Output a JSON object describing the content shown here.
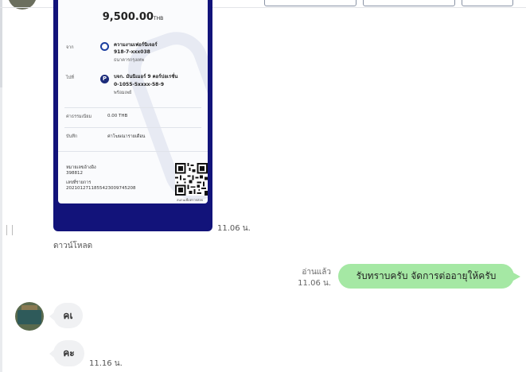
{
  "header": {
    "partial_glyph": "ๆ"
  },
  "slip": {
    "amount": "9,500.00",
    "currency": "THB",
    "from_label": "จาก",
    "from_name": "ความงามเฟอร์นิเจอร์",
    "from_account": "918-7-xxx038",
    "from_bank": "ธนาคารกรุงเทพ",
    "to_label": "ไปที่",
    "to_name": "บจก. มันนิเมอร์ 9 คอร์ปอเรชั่น",
    "to_account": "0-1055-5xxxx-58-9",
    "to_service": "พร้อมเพย์",
    "fee_label": "ค่าธรรมเนียม",
    "fee_value": "0.00 THB",
    "note_label": "บันทึก",
    "note_value": "ค่าโฆษณารายเดือน",
    "ref_label": "หมายเลขอ้างอิง",
    "ref_value": "398812",
    "txn_label": "เลขที่รายการ",
    "txn_value": "20210127118554230097452​08",
    "qr_caption": "สแกนเพื่อตรวจสอบ"
  },
  "chat": {
    "slip_time": "11.06 น.",
    "download_label": "ดาวน์โหลด",
    "read_status": "อ่านแล้ว",
    "out_time": "11.06 น.",
    "out_message": "รับทราบครับ จัดการต่ออายุให้ครับ",
    "in_message_1": "คเ",
    "in_message_2": "คะ",
    "in_time_2": "11.16 น."
  }
}
